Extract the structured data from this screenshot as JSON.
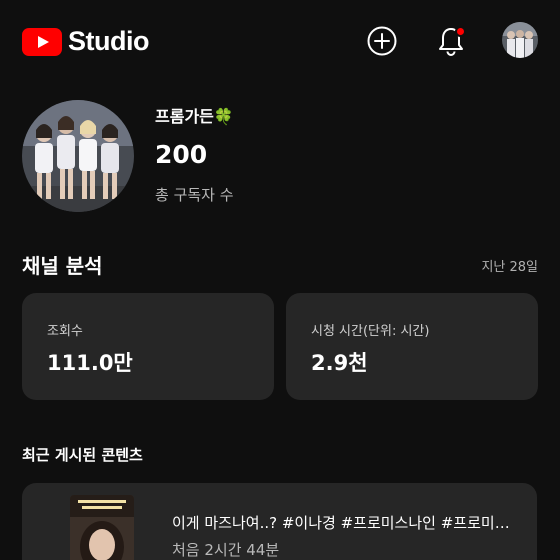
{
  "header": {
    "logo_text": "Studio",
    "brand_color": "#ff0000",
    "icons": [
      "create-icon",
      "bell-icon",
      "account-avatar"
    ]
  },
  "channel": {
    "name": "프롬가든🍀",
    "subscriber_count": "200",
    "subscriber_label": "총 구독자 수"
  },
  "analytics": {
    "title": "채널 분석",
    "period": "지난 28일",
    "cards": [
      {
        "label": "조회수",
        "value": "111.0만"
      },
      {
        "label": "시청 시간(단위: 시간)",
        "value": "2.9천"
      }
    ]
  },
  "recent": {
    "title": "최근 게시된 콘텐츠",
    "video": {
      "title": "이게 마즈나여..? #이나경 #프로미스나인 #프로미스나인",
      "meta": "처음 2시간 44분"
    }
  }
}
